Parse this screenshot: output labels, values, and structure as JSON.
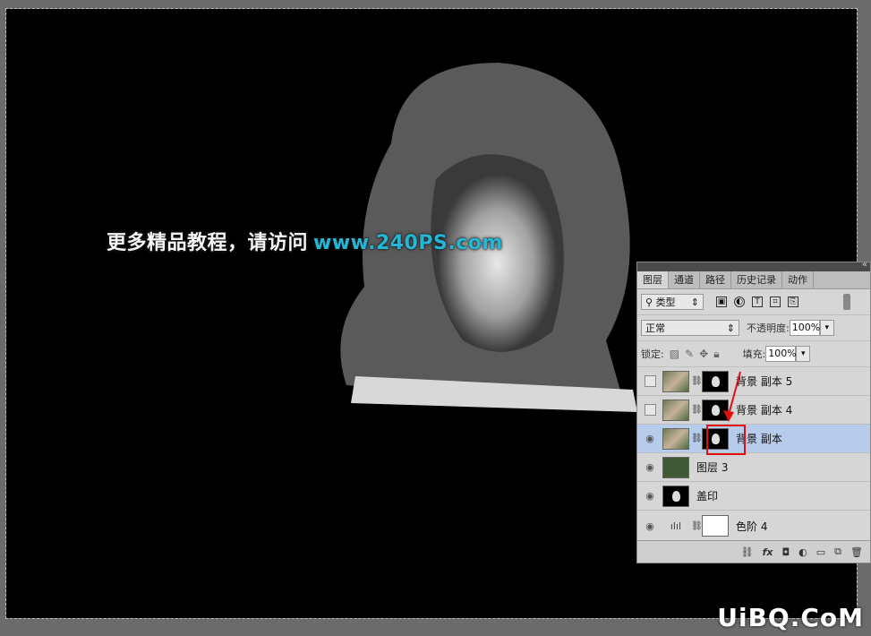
{
  "watermark": {
    "cn": "更多精品教程，请访问",
    "url": "www.240PS.com"
  },
  "brand": "UiBQ.CoM",
  "panel": {
    "tabs": [
      "图层",
      "通道",
      "路径",
      "历史记录",
      "动作"
    ],
    "filter": {
      "label": "类型"
    },
    "blend_mode": "正常",
    "opacity_label": "不透明度:",
    "opacity_value": "100%",
    "lock_label": "锁定:",
    "fill_label": "填充:",
    "fill_value": "100%",
    "layers": [
      {
        "name": "背景 副本 5",
        "visible": false
      },
      {
        "name": "背景 副本 4",
        "visible": false
      },
      {
        "name": "背景 副本",
        "visible": true,
        "selected": true
      },
      {
        "name": "图层 3",
        "visible": true
      },
      {
        "name": "盖印",
        "visible": true
      },
      {
        "name": "色阶 4",
        "visible": true
      }
    ]
  },
  "colors": {
    "selected_row": "#b7cbeb",
    "highlight_box": "#e01010",
    "url": "#25b6d6"
  }
}
